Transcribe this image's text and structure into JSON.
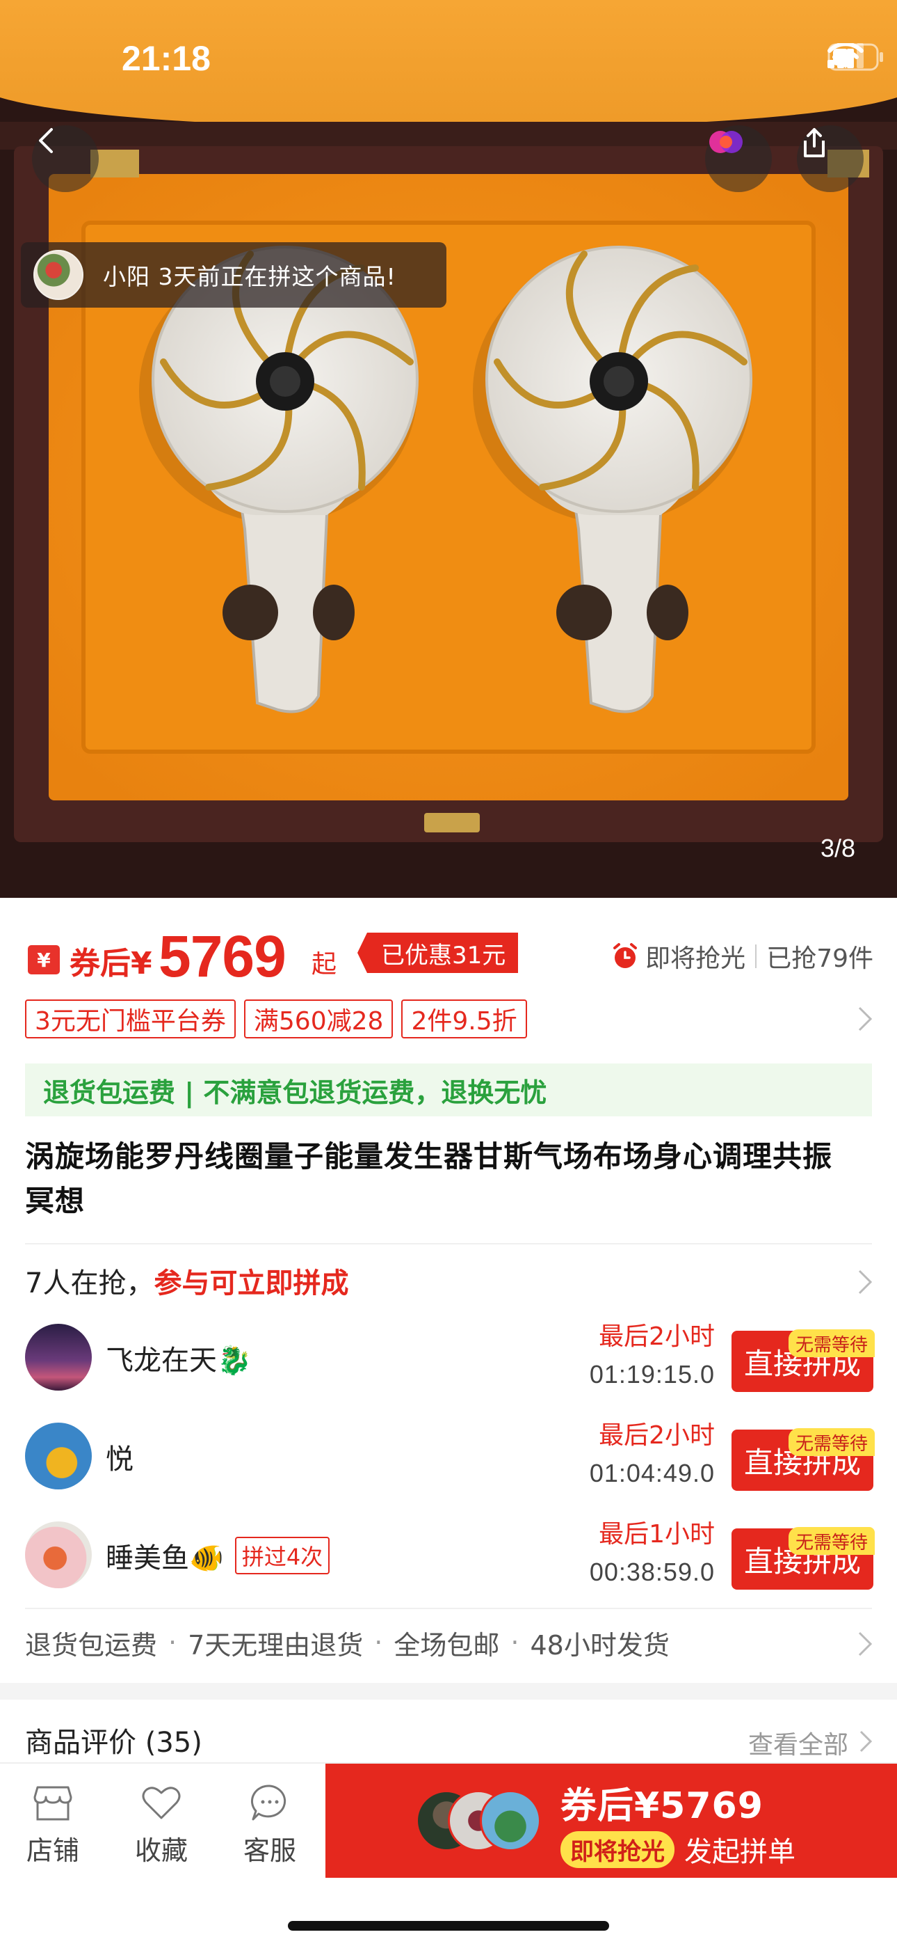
{
  "status_bar": {
    "time": "21:18"
  },
  "hero": {
    "toast_text": "小阳 3天前正在拼这个商品!",
    "page_counter": "3/8"
  },
  "price": {
    "coupon_icon": "¥",
    "prefix": "券后¥",
    "amount": "5769",
    "suffix": "起",
    "discount": "已优惠31元",
    "flash_label": "即将抢光",
    "sold": "已抢79件"
  },
  "promo_tags": [
    "3元无门槛平台券",
    "满560减28",
    "2件9.5折"
  ],
  "return_banner": "退货包运费 | 不满意包退货运费，退换无忧",
  "title": "涡旋场能罗丹线圈量子能量发生器甘斯气场布场身心调理共振冥想",
  "group": {
    "head_prefix": "7人在抢，",
    "head_highlight": "参与可立即拼成",
    "items": [
      {
        "name": "飞龙在天🐉",
        "time_label": "最后2小时",
        "countdown": "01:19:15.0",
        "button": "直接拼成",
        "badge": "无需等待",
        "tag": ""
      },
      {
        "name": "悦",
        "time_label": "最后2小时",
        "countdown": "01:04:49.0",
        "button": "直接拼成",
        "badge": "无需等待",
        "tag": ""
      },
      {
        "name": "睡美鱼🐠",
        "time_label": "最后1小时",
        "countdown": "00:38:59.0",
        "button": "直接拼成",
        "badge": "无需等待",
        "tag": "拼过4次"
      }
    ]
  },
  "services": [
    "退货包运费",
    "7天无理由退货",
    "全场包邮",
    "48小时发货"
  ],
  "reviews": {
    "title": "商品评价 (35)",
    "view_all": "查看全部"
  },
  "bottom_bar": {
    "store": "店铺",
    "favorite": "收藏",
    "service": "客服",
    "buy_price": "券后¥5769",
    "buy_flash": "即将抢光",
    "buy_label": "发起拼单"
  },
  "colors": {
    "accent": "#e5281e",
    "green": "#2aa13d",
    "yellow": "#ffe14a"
  }
}
